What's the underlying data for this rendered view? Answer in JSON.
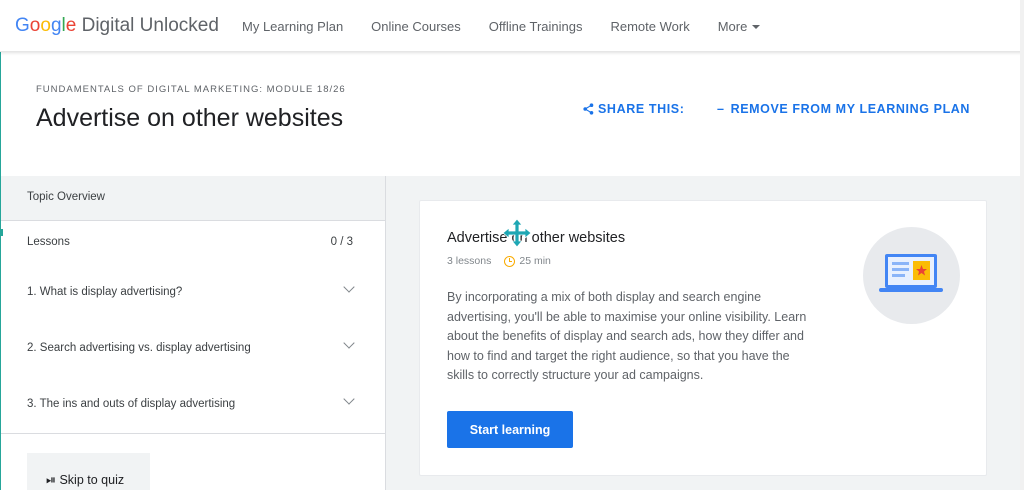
{
  "header": {
    "logo_google": "Google",
    "logo_rest": "Digital Unlocked",
    "nav": [
      {
        "label": "My Learning Plan"
      },
      {
        "label": "Online Courses"
      },
      {
        "label": "Offline Trainings"
      },
      {
        "label": "Remote Work"
      },
      {
        "label": "More"
      }
    ]
  },
  "module": {
    "label": "FUNDAMENTALS OF DIGITAL MARKETING: MODULE 18/26",
    "title": "Advertise on other websites",
    "share_label": "SHARE THIS:",
    "remove_label": "REMOVE FROM MY LEARNING PLAN",
    "remove_prefix": "–"
  },
  "sidebar": {
    "topic_overview": "Topic Overview",
    "lessons_label": "Lessons",
    "lessons_count": "0 / 3",
    "lessons": [
      {
        "label": "1. What is display advertising?"
      },
      {
        "label": "2. Search advertising vs. display advertising"
      },
      {
        "label": "3. The ins and outs of display advertising"
      }
    ],
    "skip_quiz": "⏯ Skip to quiz"
  },
  "card": {
    "title": "Advertise on other websites",
    "lessons_meta": "3 lessons",
    "duration": "25 min",
    "description": "By incorporating a mix of both display and search engine advertising, you'll be able to maximise your online visibility. Learn about the benefits of display and search ads, how they differ and how to find and target the right audience, so that you have the skills to correctly structure your ad campaigns.",
    "start_label": "Start learning"
  },
  "colors": {
    "accent": "#1a73e8",
    "clock": "#f9ab00",
    "teal_edge": "#26a69a"
  },
  "icons": [
    "share-icon",
    "chevron-down-icon",
    "clock-icon",
    "laptop-ad-illustration",
    "move-cursor-icon",
    "skip-icon"
  ]
}
